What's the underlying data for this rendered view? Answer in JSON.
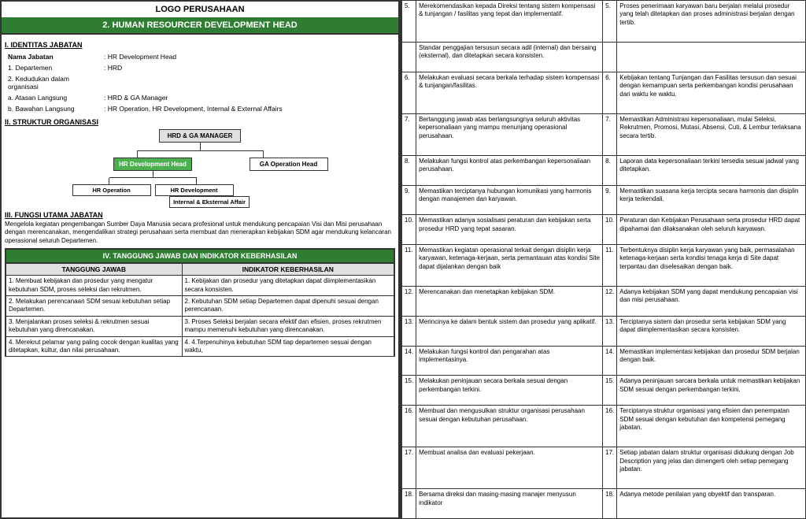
{
  "left": {
    "logo": "LOGO PERUSAHAAN",
    "title": "2. HUMAN RESOURCER DEVELOPMENT HEAD",
    "section1_title": "I.  IDENTITAS JABATAN",
    "nama_jabatan_label": "Nama Jabatan",
    "fields": [
      {
        "label": "Nama Jabatan",
        "value": ": HR Development Head"
      },
      {
        "label": "1.   Departemen",
        "value": ": HRD"
      },
      {
        "label": "2.   Kedudukan dalam organisasi",
        "value": ""
      },
      {
        "label": "a.   Atasan Langsung",
        "value": ": HRD & GA Manager"
      },
      {
        "label": "b.   Bawahan Langsung",
        "value": ": HR Operation, HR Development, Internal & External Affairs"
      }
    ],
    "section2_title": "II.   STRUKTUR ORGANISASI",
    "org": {
      "top": "HRD & GA MANAGER",
      "level2_left": "HR Development Head",
      "level2_right": "GA Operation Head",
      "level3_1": "HR Operation",
      "level3_2": "HR Development",
      "level3_3": "Internal & Eksternal Affair"
    },
    "section3_title": "III.  FUNGSI UTAMA JABATAN",
    "funsi_text": "Mengelola kegiatan pengembangan Sumber Daya Manusia secara profesional untuk mendukung pencapaian Visi dan Misi perusahaan dengan merencanakan, mengendalikan strategi perusahaan serta membuat dan menerapkan kebijakan SDM agar mendukung kelancaran operasional seluruh Departemen.",
    "section4_title": "IV. TANGGUNG JAWAB DAN INDIKATOR KEBERHASILAN",
    "col1_header": "TANGGUNG JAWAB",
    "col2_header": "INDIKATOR KEBERHASILAN",
    "rows": [
      {
        "tj": "1.  Membuat kebijakan dan prosedur yang mengatur kebutuhan SDM, proses seleksi dan rekrutmen.",
        "ik": "1.  Kebijakan dan prosedur yang ditetapkan dapat diimplementasikan secara konsisten."
      },
      {
        "tj": "2.  Melakukan perencanaan SDM sesuai kebutuhan setiap Departemen.",
        "ik": "2.  Kebutuhan SDM setiap Departemen dapat dipenuhi sesuai dengan perencanaan."
      },
      {
        "tj": "3.  Menjalankan proses seleksi & rekrutmen sesuai kebutuhan yang direncanakan.",
        "ik": "3.  Proses Seleksi berjalan secara efektif dan efisien, proses rekrutmen mampu memenuhi kebutuhan yang direncanakan."
      },
      {
        "tj": "4.  Merekrut pelamar yang paling cocok dengan kualitas yang ditetapkan, kultur, dan nilai perusahaan.",
        "ik": "4. 4.Terpenuhinya kebutuhan SDM tiap departemen sesuai dengan waktu,"
      }
    ]
  },
  "right": {
    "rows": [
      {
        "num_l": "5.",
        "tj": "Merekomendasikan kepada Direksi tentang sistem kompensasi & tunjangan / fasilitas yang tepat dan implementatif.",
        "num_r": "5.",
        "ik": "Proses penerimaan karyawan baru berjalan melalui prosedur yang telah ditetapkan dan proses administrasi berjalan dengan tertib."
      },
      {
        "num_l": "",
        "tj": "Standar penggajian tersusun secara adil (internal) dan bersaing (eksternal), dan ditetapkan secara konsisten.",
        "num_r": "",
        "ik": ""
      },
      {
        "num_l": "6.",
        "tj": "Melakukan evaluasi secara berkala terhadap sistem kompensasi & tunjangan/fasilitas.",
        "num_r": "6.",
        "ik": "Kebijakan tentang Tunjangan dan Fasilitas tersusun dan sesuai dengan kemampuan serta perkembangan kondisi perusahaan dari waktu ke waktu."
      },
      {
        "num_l": "7.",
        "tj": "Bertanggung jawab atas berlangsungnya seluruh aktivitas kepersonaliaan yang mampu menunjang operasional perusahaan.",
        "num_r": "7.",
        "ik": "Memastikan Administrasi kepersonaliaan, mulai Seleksi, Rekrutmen, Promosi, Mutasi, Absensi, Cuti, & Lembur terlaksana secara tertib."
      },
      {
        "num_l": "8.",
        "tj": "Melakukan fungsi kontrol atas perkembangan kepersonaliaan perusahaan.",
        "num_r": "8.",
        "ik": "Laporan data kepersonaliaan terkini tersedia sesuai jadwal yang ditetapkan."
      },
      {
        "num_l": "9.",
        "tj": "Memastikan terciptanya hubungan komunikasi yang harmonis dengan manajemen dan karyawan.",
        "num_r": "9.",
        "ik": "Memastikan suasana kerja tercipta secara harmonis dan disiplin kerja terkendali."
      },
      {
        "num_l": "10.",
        "tj": "Memastikan adanya sosialisasi peraturan dan kebijakan serta prosedur HRD yang tepat sasaran.",
        "num_r": "10.",
        "ik": "Peraturan dan Kebijakan Perusahaan serta prosedur HRD dapat dipahamai dan dilaksanakan oleh seluruh karyawan."
      },
      {
        "num_l": "11.",
        "tj": "Memastikan kegiatan operasional terkait dengan disiplin kerja karyawan, ketenaga-kerjaan, serta pemantauan atas kondisi Site dapat dijalankan dengan baik",
        "num_r": "11.",
        "ik": "Terbentuknya disiplin kerja karyawan yang baik, permasalahan ketenaga-kerjaan serta kondisi tenaga kerja di Site dapat terpantau dan diselesaikan dengan baik."
      },
      {
        "num_l": "12.",
        "tj": "Merencanakan dan menetapkan kebijakan SDM.",
        "num_r": "12.",
        "ik": "Adanya kebijakan SDM yang dapat mendukung pencapaian visi dan misi perusahaan."
      },
      {
        "num_l": "13.",
        "tj": "Merincinya ke dalam bentuk sistem dan prosedur yang aplikatif.",
        "num_r": "13.",
        "ik": "Terciptanya sistem dan prosedur serta kebijakan SDM yang dapat diimplementasikan secara konsisten."
      },
      {
        "num_l": "14.",
        "tj": "Melakukan fungsi kontrol dan pengarahan atas implementasinya.",
        "num_r": "14.",
        "ik": "Memastikan implementasi kebijakan dan prosedur SDM berjalan dengan baik."
      },
      {
        "num_l": "15.",
        "tj": "Melakukan peninjauan secara berkala sesuai dengan perkembangan terkini.",
        "num_r": "15.",
        "ik": "Adanya peninjauan sarcara berkala untuk memastikan kebijakan SDM sesuai dengan perkembangan terkini."
      },
      {
        "num_l": "16.",
        "tj": "Membuat dan mengusulkan struktur organisasi perusahaan sesuai dengan kebutuhan perusahaan.",
        "num_r": "16.",
        "ik": "Terciptanya struktur organisasi yang efisien dan penempatan SDM sesuai dengan kebutuhan dan kompetensi pemegang jabatan."
      },
      {
        "num_l": "17.",
        "tj": "Membuat analisa dan evaluasi pekerjaan.",
        "num_r": "17.",
        "ik": "Setiap jabatan dalam struktur organisasi didukung dengan Job Description yang jelas dan dimengerti oleh setiap pemegang jabatan."
      },
      {
        "num_l": "18.",
        "tj": "Bersama direksi dan masing-masing manajer menyusun indikator",
        "num_r": "18.",
        "ik": "Adanya metode penilaian yang obyektif dan transparan."
      }
    ]
  }
}
